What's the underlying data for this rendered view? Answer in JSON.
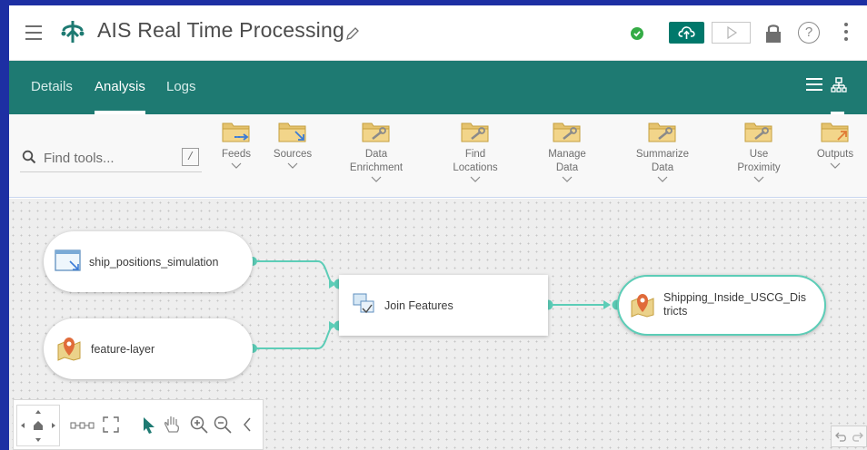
{
  "app": {
    "title": "AIS Real Time Processing",
    "accent_color": "#1e7a72",
    "status_color": "#35ac46",
    "icons": [
      "hamburger-icon",
      "app-logo-icon",
      "pencil-icon",
      "check-icon",
      "cloud-upload-icon",
      "play-icon",
      "lock-icon",
      "help-icon",
      "more-vertical-icon"
    ]
  },
  "help": {
    "label": "?"
  },
  "nav": {
    "tabs": [
      {
        "label": "Details"
      },
      {
        "label": "Analysis"
      },
      {
        "label": "Logs"
      }
    ],
    "active_tab": "Analysis"
  },
  "toolbar": {
    "search": {
      "placeholder": "Find tools...",
      "shortcut": "/"
    },
    "tools": [
      {
        "label_1": "Feeds",
        "label_2": ""
      },
      {
        "label_1": "Sources",
        "label_2": ""
      },
      {
        "label_1": "Data",
        "label_2": "Enrichment"
      },
      {
        "label_1": "Find",
        "label_2": "Locations"
      },
      {
        "label_1": "Manage",
        "label_2": "Data"
      },
      {
        "label_1": "Summarize",
        "label_2": "Data"
      },
      {
        "label_1": "Use",
        "label_2": "Proximity"
      },
      {
        "label_1": "Outputs",
        "label_2": ""
      }
    ]
  },
  "canvas": {
    "nodes": [
      {
        "label": "ship_positions_simulation",
        "icon": "feed-icon"
      },
      {
        "label": "feature-layer",
        "icon": "map-pin-icon"
      },
      {
        "label": "Join Features",
        "icon": "join-features-icon"
      },
      {
        "label": "Shipping_Inside_USCG_Dis",
        "label_2": "tricts",
        "icon": "map-pin-icon"
      }
    ],
    "wire_color": "#5ccdb7",
    "controls": [
      "pan-pad",
      "fit-layout-icon",
      "fullscreen-icon",
      "select-arrow-icon",
      "pan-hand-icon",
      "zoom-in-icon",
      "zoom-out-icon",
      "collapse-icon",
      "undo-icon",
      "redo-icon"
    ]
  }
}
